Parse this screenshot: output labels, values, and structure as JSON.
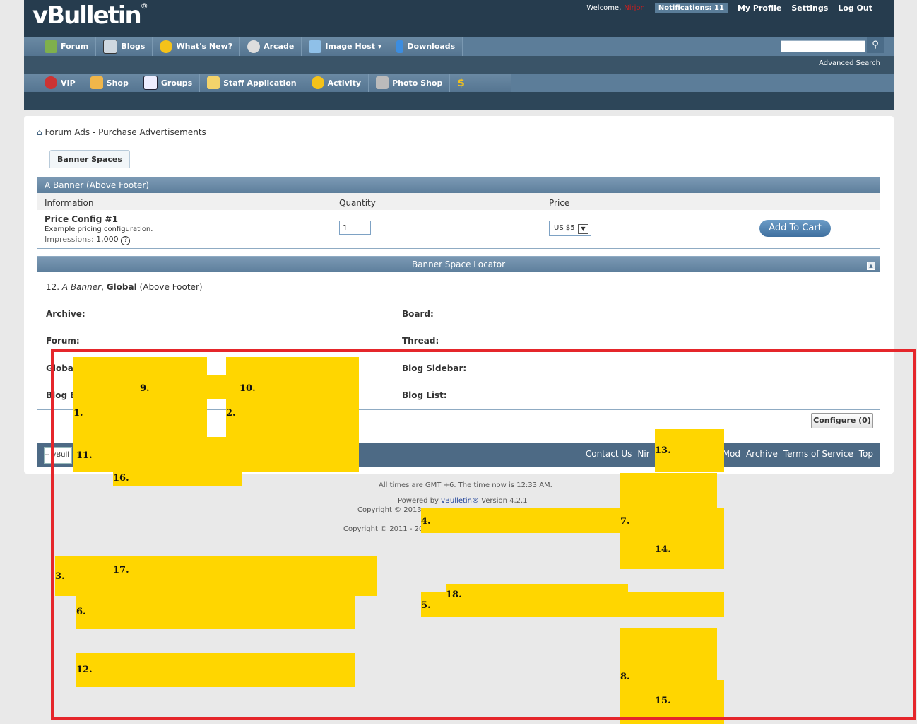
{
  "header": {
    "logo": "vBulletin",
    "logo_mark": "®",
    "welcome": "Welcome,",
    "username": "Nirjon",
    "notifications": "Notifications: 11",
    "links": [
      "My Profile",
      "Settings",
      "Log Out"
    ],
    "advanced_search": "Advanced Search"
  },
  "nav_primary": [
    {
      "label": "Forum",
      "icon": "forum-icon"
    },
    {
      "label": "Blogs",
      "icon": "blogs-icon"
    },
    {
      "label": "What's New?",
      "icon": "new-icon"
    },
    {
      "label": "Arcade",
      "icon": "arcade-icon"
    },
    {
      "label": "Image Host ▾",
      "icon": "image-host-icon"
    },
    {
      "label": "Downloads",
      "icon": "download-arrow-icon"
    }
  ],
  "nav_secondary": [
    {
      "label": "VIP",
      "icon": "vip-icon"
    },
    {
      "label": "Shop",
      "icon": "shop-icon"
    },
    {
      "label": "Groups",
      "icon": "groups-icon"
    },
    {
      "label": "Staff Application",
      "icon": "staff-icon"
    },
    {
      "label": "Activity",
      "icon": "activity-icon"
    },
    {
      "label": "Photo Shop",
      "icon": "photo-shop-icon"
    },
    {
      "label": "",
      "icon": "dollar-icon"
    }
  ],
  "breadcrumb": "Forum Ads - Purchase Advertisements",
  "tab": "Banner Spaces",
  "banner_block": {
    "title": "A Banner (Above Footer)",
    "columns": [
      "Information",
      "Quantity",
      "Price"
    ],
    "config_name": "Price Config #1",
    "config_desc": "Example pricing configuration.",
    "impressions_label": "Impressions:",
    "impressions_value": "1,000",
    "quantity": "1",
    "price": "US $5",
    "add_to_cart": "Add To Cart"
  },
  "locator": {
    "title": "Banner Space Locator",
    "line_num": "12.",
    "line_a": "A Banner",
    "line_global": "Global",
    "line_rest": "(Above Footer)",
    "archive": "Archive:",
    "board": "Board:",
    "forum": "Forum:",
    "thread": "Thread:",
    "global": "Global",
    "blog_sidebar": "Blog Sidebar:",
    "blog_e": "Blog E",
    "blog_list": "Blog List:"
  },
  "configure": "Configure (0)",
  "footer": {
    "style_select": "-- vBull",
    "links": [
      "Contact Us",
      "Nir",
      "Mod",
      "Archive",
      "Terms of Service",
      "Top"
    ]
  },
  "bottom": {
    "time": "All times are GMT +6. The time now is 12:33 AM.",
    "powered_pre": "Powered by ",
    "powered_link": "vBulletin®",
    "powered_post": " Version 4.2.1",
    "copyright1": "Copyright © 2013 v",
    "copyright2": "Copyright © 2011 - 201"
  },
  "overlay_numbers": [
    "1.",
    "2.",
    "3.",
    "4.",
    "5.",
    "6.",
    "7.",
    "8.",
    "9.",
    "10.",
    "11.",
    "12.",
    "13.",
    "14.",
    "15.",
    "16.",
    "17.",
    "18."
  ],
  "colors": {
    "header": "#263c4e",
    "nav": "#5c7d99",
    "highlight": "#ffd600",
    "frame": "#e5262b"
  }
}
